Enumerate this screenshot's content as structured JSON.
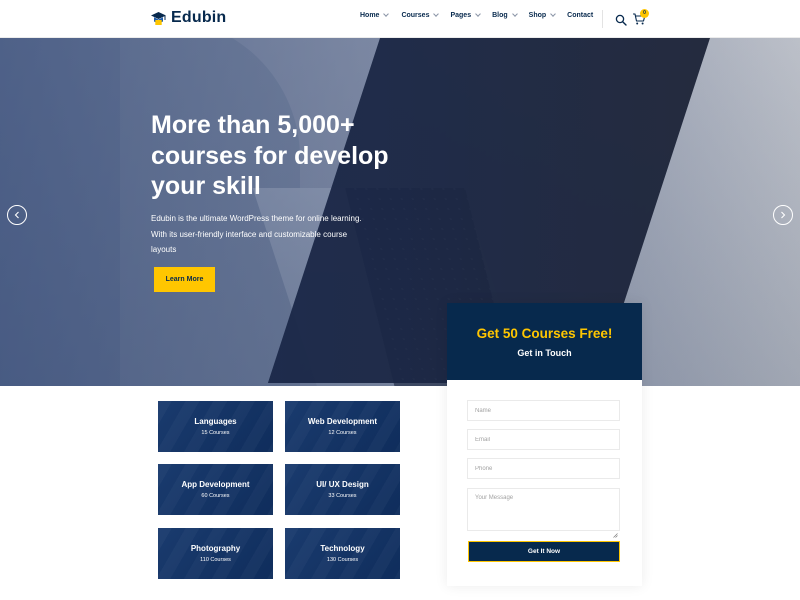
{
  "header": {
    "logo_text": "Edubin",
    "nav": [
      {
        "label": "Home",
        "has_dropdown": true
      },
      {
        "label": "Courses",
        "has_dropdown": true
      },
      {
        "label": "Pages",
        "has_dropdown": true
      },
      {
        "label": "Blog",
        "has_dropdown": true
      },
      {
        "label": "Shop",
        "has_dropdown": true
      },
      {
        "label": "Contact",
        "has_dropdown": false
      }
    ],
    "cart_count": "0",
    "icons": [
      "search-icon",
      "cart-icon"
    ]
  },
  "hero": {
    "title": "More than 5,000+ courses for develop your skill",
    "description": "Edubin is the ultimate WordPress theme for online learning. With its user-friendly interface and customizable course layouts",
    "button_label": "Learn More",
    "prev_icon": "chevron-left-icon",
    "next_icon": "chevron-right-icon"
  },
  "categories": [
    {
      "name": "Languages",
      "count": "15 Courses"
    },
    {
      "name": "Web Development",
      "count": "12 Courses"
    },
    {
      "name": "App Development",
      "count": "60 Courses"
    },
    {
      "name": "UI/ UX Design",
      "count": "33 Courses"
    },
    {
      "name": "Photography",
      "count": "110 Courses"
    },
    {
      "name": "Technology",
      "count": "130 Courses"
    }
  ],
  "form": {
    "title": "Get 50 Courses Free!",
    "subtitle": "Get in Touch",
    "fields": {
      "name": {
        "placeholder": "Name",
        "value": ""
      },
      "email": {
        "placeholder": "Email",
        "value": ""
      },
      "phone": {
        "placeholder": "Phone",
        "value": ""
      },
      "message": {
        "placeholder": "Your Message",
        "value": ""
      }
    },
    "submit_label": "Get It Now"
  },
  "colors": {
    "primary": "#07294d",
    "accent": "#ffc600",
    "white": "#ffffff"
  }
}
